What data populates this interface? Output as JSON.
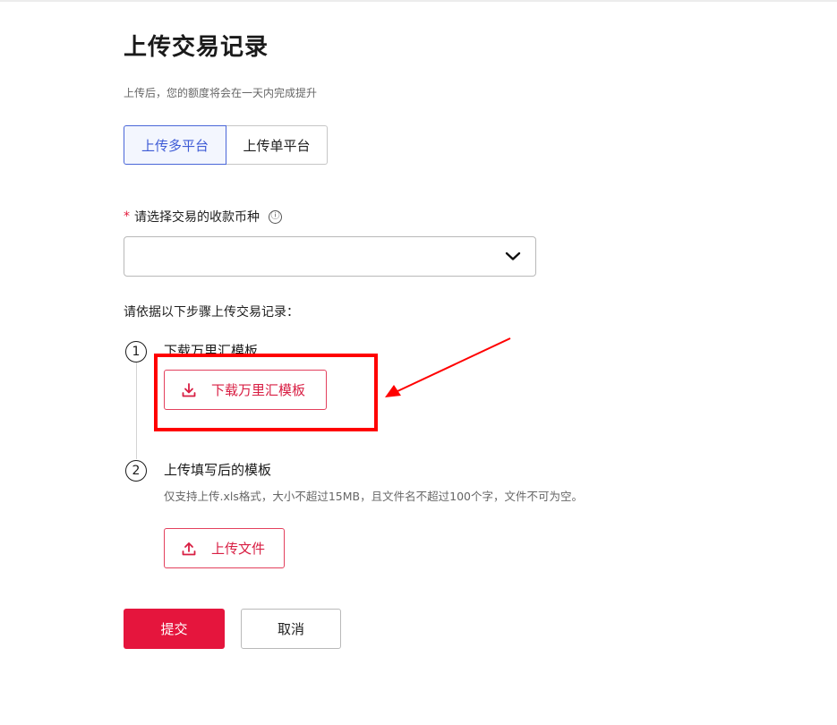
{
  "page": {
    "title": "上传交易记录",
    "subtitle": "上传后，您的额度将会在一天内完成提升"
  },
  "platform_toggle": {
    "multi_label": "上传多平台",
    "single_label": "上传单平台",
    "selected": "multi"
  },
  "currency_field": {
    "required_mark": "*",
    "label": "请选择交易的收款币种",
    "info_icon": "ⓘ",
    "value": ""
  },
  "steps": {
    "intro": "请依据以下步骤上传交易记录：",
    "items": [
      {
        "number": "1",
        "title": "下载万里汇模板",
        "button_label": "下载万里汇模板",
        "button_icon": "download-icon"
      },
      {
        "number": "2",
        "title": "上传填写后的模板",
        "description": "仅支持上传.xls格式，大小不超过15MB，且文件名不超过100个字，文件不可为空。",
        "button_label": "上传文件",
        "button_icon": "upload-icon"
      }
    ]
  },
  "actions": {
    "submit_label": "提交",
    "cancel_label": "取消"
  },
  "colors": {
    "brand_red": "#e5153d",
    "active_blue": "#3e5bd6",
    "annotation_red": "#ff0000"
  }
}
